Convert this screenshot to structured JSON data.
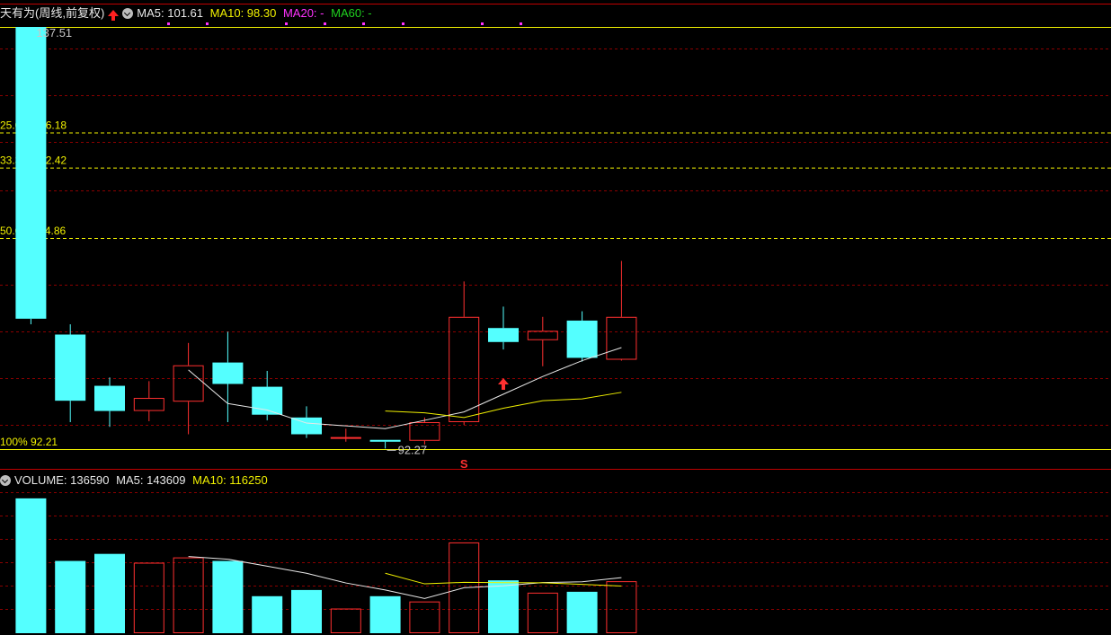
{
  "header": {
    "title": "天有为(周线,前复权)",
    "ma5": "MA5: 101.61",
    "ma10": "MA10: 98.30",
    "ma20": "MA20: -",
    "ma60": "MA60: -"
  },
  "volume_header": {
    "volume": "VOLUME: 136590",
    "ma5": "MA5: 143609",
    "ma10": "MA10: 116250"
  },
  "colors": {
    "background": "#000000",
    "up": "#ff3030",
    "down": "#54ffff",
    "ma5": "#e8e8e8",
    "ma10": "#f0f000",
    "ma20": "#ff33ff",
    "ma60": "#1fd01f",
    "fib": "#f0f000",
    "grid": "#8b0000"
  },
  "chart_data": [
    {
      "type": "candlestick",
      "title": "天有为(周线,前复权)",
      "ylim": [
        92.21,
        137.51
      ],
      "price_labels": {
        "high": "137.51",
        "low": "92.27"
      },
      "fibonacci": [
        {
          "label": "25.0%",
          "value": 126.18
        },
        {
          "label": "33.3%",
          "value": 122.42
        },
        {
          "label": "50.0%",
          "value": 114.86
        },
        {
          "label": "100%",
          "value": 92.21
        }
      ],
      "candles": [
        {
          "open": 137.51,
          "close": 106.2,
          "high": 137.51,
          "low": 105.6,
          "dir": "down"
        },
        {
          "open": 104.5,
          "close": 97.4,
          "high": 105.6,
          "low": 95.1,
          "dir": "down"
        },
        {
          "open": 99.0,
          "close": 96.3,
          "high": 99.9,
          "low": 94.6,
          "dir": "down"
        },
        {
          "open": 96.3,
          "close": 97.7,
          "high": 99.5,
          "low": 95.2,
          "dir": "up"
        },
        {
          "open": 97.3,
          "close": 101.2,
          "high": 103.6,
          "low": 93.8,
          "dir": "up"
        },
        {
          "open": 101.5,
          "close": 99.2,
          "high": 104.8,
          "low": 95.1,
          "dir": "down"
        },
        {
          "open": 98.9,
          "close": 95.9,
          "high": 100.6,
          "low": 95.3,
          "dir": "down"
        },
        {
          "open": 95.6,
          "close": 93.8,
          "high": 96.8,
          "low": 93.4,
          "dir": "down"
        },
        {
          "open": 93.5,
          "close": 93.5,
          "high": 94.4,
          "low": 93.0,
          "dir": "up"
        },
        {
          "open": 93.2,
          "close": 93.0,
          "high": 93.2,
          "low": 92.27,
          "dir": "down"
        },
        {
          "open": 93.1,
          "close": 95.1,
          "high": 95.6,
          "low": 92.7,
          "dir": "up"
        },
        {
          "open": 95.1,
          "close": 106.4,
          "high": 110.2,
          "low": 94.8,
          "dir": "up"
        },
        {
          "open": 105.2,
          "close": 103.7,
          "high": 107.5,
          "low": 102.9,
          "dir": "down"
        },
        {
          "open": 103.9,
          "close": 104.9,
          "high": 106.4,
          "low": 101.1,
          "dir": "up"
        },
        {
          "open": 106.0,
          "close": 102.0,
          "high": 107.0,
          "low": 101.6,
          "dir": "down"
        },
        {
          "open": 101.8,
          "close": 106.4,
          "high": 112.4,
          "low": 101.7,
          "dir": "up"
        }
      ],
      "ma5": [
        null,
        null,
        null,
        null,
        100.7,
        97.1,
        96.4,
        95.0,
        94.7,
        94.4,
        95.3,
        96.2,
        98.1,
        100.0,
        101.7,
        103.1
      ],
      "ma10": [
        null,
        null,
        null,
        null,
        null,
        null,
        null,
        null,
        null,
        96.3,
        96.1,
        95.6,
        96.6,
        97.4,
        97.6,
        98.3
      ],
      "markers": [
        {
          "index": 12,
          "type": "up-arrow"
        },
        {
          "index": 11,
          "type": "text",
          "text": "S"
        }
      ]
    },
    {
      "type": "bar",
      "title": "VOLUME",
      "ylim": [
        0,
        160000
      ],
      "values": [
        153000,
        82000,
        90000,
        80000,
        86000,
        82000,
        42000,
        49000,
        28000,
        42000,
        36000,
        103000,
        60000,
        46000,
        47000,
        59000
      ],
      "dirs": [
        "down",
        "down",
        "down",
        "up",
        "up",
        "down",
        "down",
        "down",
        "up",
        "down",
        "up",
        "up",
        "down",
        "up",
        "down",
        "up"
      ],
      "ma5": [
        null,
        null,
        null,
        null,
        87000,
        84000,
        76000,
        68000,
        57000,
        49000,
        39400,
        51600,
        53800,
        57400,
        58400,
        63000
      ],
      "ma10": [
        null,
        null,
        null,
        null,
        null,
        null,
        null,
        null,
        null,
        68000,
        56000,
        57700,
        57300,
        57200,
        55400,
        53500
      ]
    }
  ]
}
